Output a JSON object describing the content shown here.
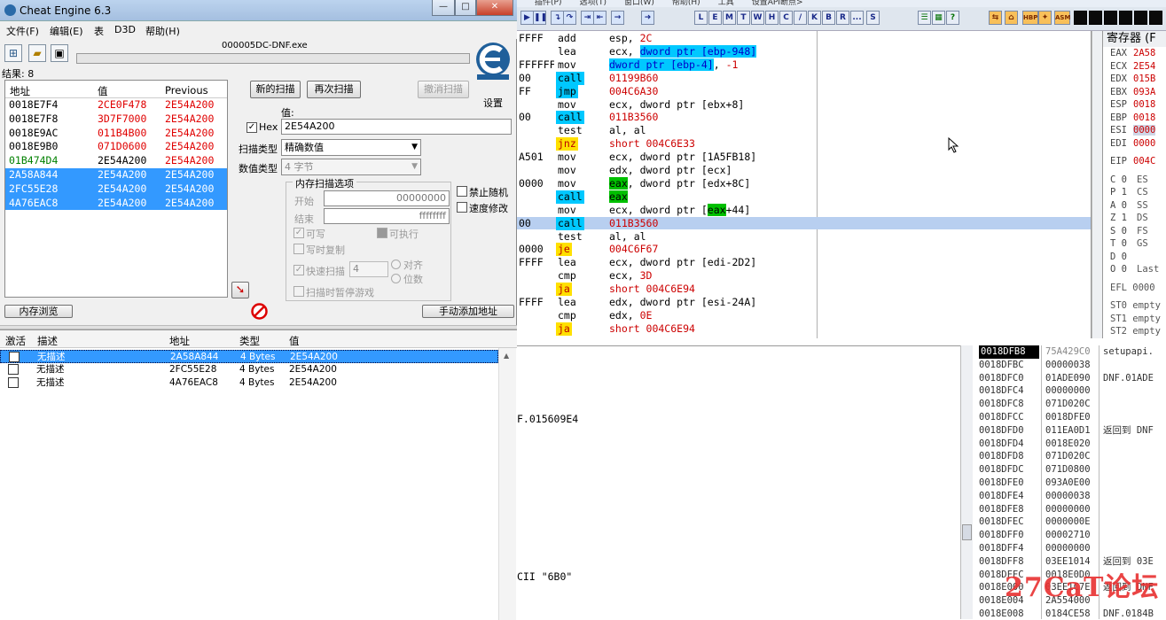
{
  "ce": {
    "window_title": "Cheat Engine 6.3",
    "window_buttons": [
      "—",
      "□",
      "✕"
    ],
    "menu": [
      "文件(F)",
      "编辑(E)",
      "表",
      "D3D",
      "帮助(H)"
    ],
    "process_name": "000005DC-DNF.exe",
    "results_label": "结果: 8",
    "results_headers": [
      "地址",
      "值",
      "Previous"
    ],
    "results": [
      {
        "addr": "0018E7F4",
        "value": "2CE0F478",
        "prev": "2E54A200",
        "changed": true,
        "green": false,
        "selected": false
      },
      {
        "addr": "0018E7F8",
        "value": "3D7F7000",
        "prev": "2E54A200",
        "changed": true,
        "green": false,
        "selected": false
      },
      {
        "addr": "0018E9AC",
        "value": "011B4B00",
        "prev": "2E54A200",
        "changed": true,
        "green": false,
        "selected": false
      },
      {
        "addr": "0018E9B0",
        "value": "071D0600",
        "prev": "2E54A200",
        "changed": true,
        "green": false,
        "selected": false
      },
      {
        "addr": "01B474D4",
        "value": "2E54A200",
        "prev": "2E54A200",
        "changed": false,
        "green": true,
        "selected": false
      },
      {
        "addr": "2A58A844",
        "value": "2E54A200",
        "prev": "2E54A200",
        "changed": false,
        "green": false,
        "selected": true
      },
      {
        "addr": "2FC55E28",
        "value": "2E54A200",
        "prev": "2E54A200",
        "changed": false,
        "green": false,
        "selected": true
      },
      {
        "addr": "4A76EAC8",
        "value": "2E54A200",
        "prev": "2E54A200",
        "changed": false,
        "green": false,
        "selected": true
      }
    ],
    "new_scan": "新的扫描",
    "next_scan": "再次扫描",
    "undo_scan": "撤消扫描",
    "settings": "设置",
    "value_label": "值:",
    "hex_label": "Hex",
    "hex_checked": "✓",
    "value": "2E54A200",
    "scan_type_label": "扫描类型",
    "scan_type": "精确数值",
    "value_type_label": "数值类型",
    "value_type": "4 字节",
    "mem_options_title": "内存扫描选项",
    "start_label": "开始",
    "start_value": "00000000",
    "stop_label": "结束",
    "stop_value": "ffffffff",
    "writable": "可写",
    "executable": "可执行",
    "copy_on_write": "写时复制",
    "fast_scan": "快速扫描",
    "fast_scan_value": "4",
    "align": "对齐",
    "last_digits": "位数",
    "pause_game": "扫描时暂停游戏",
    "no_random": "禁止随机",
    "speedhack": "速度修改",
    "mem_view": "内存浏览",
    "add_manually": "手动添加地址",
    "addr_headers": [
      "激活",
      "描述",
      "地址",
      "类型",
      "值"
    ],
    "addr_rows": [
      {
        "desc": "无描述",
        "addr": "2A58A844",
        "type": "4 Bytes",
        "value": "2E54A200",
        "selected": true
      },
      {
        "desc": "无描述",
        "addr": "2FC55E28",
        "type": "4 Bytes",
        "value": "2E54A200",
        "selected": false
      },
      {
        "desc": "无描述",
        "addr": "4A76EAC8",
        "type": "4 Bytes",
        "value": "2E54A200",
        "selected": false
      }
    ]
  },
  "od": {
    "menu_partial": [
      "插件(P)",
      "选项(T)",
      "窗口(W)",
      "帮助(H)",
      "工具",
      "设置API断点>"
    ],
    "toolbar_letters": [
      "L",
      "E",
      "M",
      "T",
      "W",
      "H",
      "C",
      "/",
      "K",
      "B",
      "R",
      "...",
      "S"
    ],
    "orange_buttons": [
      "HBP",
      "ASM"
    ],
    "disasm": [
      {
        "hex": "FFFF",
        "mn": "add",
        "kind": "plain",
        "op": [
          [
            "esp, ",
            ""
          ],
          [
            "2C",
            "red"
          ]
        ],
        "sel": false
      },
      {
        "hex": "",
        "mn": "lea",
        "kind": "plain",
        "op": [
          [
            "ecx, ",
            ""
          ],
          [
            "dword ptr [ebp-948]",
            "hlb"
          ]
        ],
        "sel": false
      },
      {
        "hex": "FFFFFF",
        "mn": "mov",
        "kind": "plain",
        "op": [
          [
            "dword ptr [ebp-4]",
            "hlb"
          ],
          [
            ", ",
            ""
          ],
          [
            "-1",
            "red"
          ]
        ],
        "sel": false
      },
      {
        "hex": "00",
        "mn": "call",
        "kind": "call",
        "op": [
          [
            "01199B60",
            "red"
          ]
        ],
        "sel": false
      },
      {
        "hex": "FF",
        "mn": "jmp",
        "kind": "jmp",
        "op": [
          [
            "004C6A30",
            "red"
          ]
        ],
        "sel": false
      },
      {
        "hex": "",
        "mn": "mov",
        "kind": "plain",
        "op": [
          [
            "ecx, dword ptr [ebx+8]",
            ""
          ]
        ],
        "sel": false
      },
      {
        "hex": "00",
        "mn": "call",
        "kind": "call",
        "op": [
          [
            "011B3560",
            "red"
          ]
        ],
        "sel": false
      },
      {
        "hex": "",
        "mn": "test",
        "kind": "plain",
        "op": [
          [
            "al, al",
            ""
          ]
        ],
        "sel": false
      },
      {
        "hex": "",
        "mn": "jnz",
        "kind": "jcc",
        "op": [
          [
            "short 004C6E33",
            "red"
          ]
        ],
        "sel": false
      },
      {
        "hex": "A501",
        "mn": "mov",
        "kind": "plain",
        "op": [
          [
            "ecx, dword ptr [1A5FB18]",
            ""
          ]
        ],
        "sel": false
      },
      {
        "hex": "",
        "mn": "mov",
        "kind": "plain",
        "op": [
          [
            "edx, dword ptr [ecx]",
            ""
          ]
        ],
        "sel": false
      },
      {
        "hex": "0000",
        "mn": "mov",
        "kind": "plain",
        "op": [
          [
            "eax",
            "hlg"
          ],
          [
            ", dword ptr [edx+8C]",
            ""
          ]
        ],
        "sel": false
      },
      {
        "hex": "",
        "mn": "call",
        "kind": "call",
        "op": [
          [
            "eax",
            "hlg"
          ]
        ],
        "sel": false
      },
      {
        "hex": "",
        "mn": "mov",
        "kind": "plain",
        "op": [
          [
            "ecx, dword ptr [",
            ""
          ],
          [
            "eax",
            "hlg"
          ],
          [
            "+44]",
            ""
          ]
        ],
        "sel": false
      },
      {
        "hex": "00",
        "mn": "call",
        "kind": "call",
        "op": [
          [
            "011B3560",
            "red"
          ]
        ],
        "sel": true
      },
      {
        "hex": "",
        "mn": "test",
        "kind": "plain",
        "op": [
          [
            "al, al",
            ""
          ]
        ],
        "sel": false
      },
      {
        "hex": "0000",
        "mn": "je",
        "kind": "jcc",
        "op": [
          [
            "004C6F67",
            "red"
          ]
        ],
        "sel": false
      },
      {
        "hex": "FFFF",
        "mn": "lea",
        "kind": "plain",
        "op": [
          [
            "ecx, dword ptr [edi-2D2]",
            ""
          ]
        ],
        "sel": false
      },
      {
        "hex": "",
        "mn": "cmp",
        "kind": "plain",
        "op": [
          [
            "ecx, ",
            ""
          ],
          [
            "3D",
            "red"
          ]
        ],
        "sel": false
      },
      {
        "hex": "",
        "mn": "ja",
        "kind": "jcc",
        "op": [
          [
            "short 004C6E94",
            "red"
          ]
        ],
        "sel": false
      },
      {
        "hex": "FFFF",
        "mn": "lea",
        "kind": "plain",
        "op": [
          [
            "edx, dword ptr [esi-24A]",
            ""
          ]
        ],
        "sel": false
      },
      {
        "hex": "",
        "mn": "cmp",
        "kind": "plain",
        "op": [
          [
            "edx, ",
            ""
          ],
          [
            "0E",
            "red"
          ]
        ],
        "sel": false
      },
      {
        "hex": "",
        "mn": "ja",
        "kind": "jcc",
        "op": [
          [
            "short 004C6E94",
            "red"
          ]
        ],
        "sel": false
      }
    ],
    "regs_title": "寄存器 (F",
    "regs": [
      {
        "n": "EAX",
        "v": "2A58"
      },
      {
        "n": "ECX",
        "v": "2E54"
      },
      {
        "n": "EDX",
        "v": "015B"
      },
      {
        "n": "EBX",
        "v": "093A"
      },
      {
        "n": "ESP",
        "v": "0018"
      },
      {
        "n": "EBP",
        "v": "0018"
      },
      {
        "n": "ESI",
        "v": "0000"
      },
      {
        "n": "EDI",
        "v": "0000"
      }
    ],
    "eip": {
      "n": "EIP",
      "v": "004C"
    },
    "flags": [
      {
        "f": "C 0",
        "s": "ES"
      },
      {
        "f": "P 1",
        "s": "CS"
      },
      {
        "f": "A 0",
        "s": "SS"
      },
      {
        "f": "Z 1",
        "s": "DS"
      },
      {
        "f": "S 0",
        "s": "FS"
      },
      {
        "f": "T 0",
        "s": "GS"
      },
      {
        "f": "D 0",
        "s": ""
      },
      {
        "f": "O 0",
        "s": "Last"
      }
    ],
    "efl": "EFL 0000",
    "st": [
      "ST0 empty",
      "ST1 empty",
      "ST2 empty"
    ],
    "dump_lines": [
      "F.015609E4",
      "CII \"6B0\""
    ],
    "stack": [
      {
        "a": "0018DFB8",
        "v": "75A429C0",
        "c": "setupapi."
      },
      {
        "a": "0018DFBC",
        "v": "00000038",
        "c": ""
      },
      {
        "a": "0018DFC0",
        "v": "01ADE090",
        "c": "DNF.01ADE"
      },
      {
        "a": "0018DFC4",
        "v": "00000000",
        "c": ""
      },
      {
        "a": "0018DFC8",
        "v": "071D020C",
        "c": ""
      },
      {
        "a": "0018DFCC",
        "v": "0018DFE0",
        "c": ""
      },
      {
        "a": "0018DFD0",
        "v": "011EA0D1",
        "c": "返回到 DNF"
      },
      {
        "a": "0018DFD4",
        "v": "0018E020",
        "c": ""
      },
      {
        "a": "0018DFD8",
        "v": "071D020C",
        "c": ""
      },
      {
        "a": "0018DFDC",
        "v": "071D0800",
        "c": ""
      },
      {
        "a": "0018DFE0",
        "v": "093A0E00",
        "c": ""
      },
      {
        "a": "0018DFE4",
        "v": "00000038",
        "c": ""
      },
      {
        "a": "0018DFE8",
        "v": "00000000",
        "c": ""
      },
      {
        "a": "0018DFEC",
        "v": "0000000E",
        "c": ""
      },
      {
        "a": "0018DFF0",
        "v": "00002710",
        "c": ""
      },
      {
        "a": "0018DFF4",
        "v": "00000000",
        "c": ""
      },
      {
        "a": "0018DFF8",
        "v": "03EE1014",
        "c": "返回到 03E"
      },
      {
        "a": "0018DFFC",
        "v": "0018E0D0",
        "c": ""
      },
      {
        "a": "0018E000",
        "v": "03EE1C7E",
        "c": "返回到 DNF"
      },
      {
        "a": "0018E004",
        "v": "2A554000",
        "c": ""
      },
      {
        "a": "0018E008",
        "v": "0184CE58",
        "c": "DNF.0184B"
      }
    ]
  },
  "watermark": "27CaT论坛"
}
